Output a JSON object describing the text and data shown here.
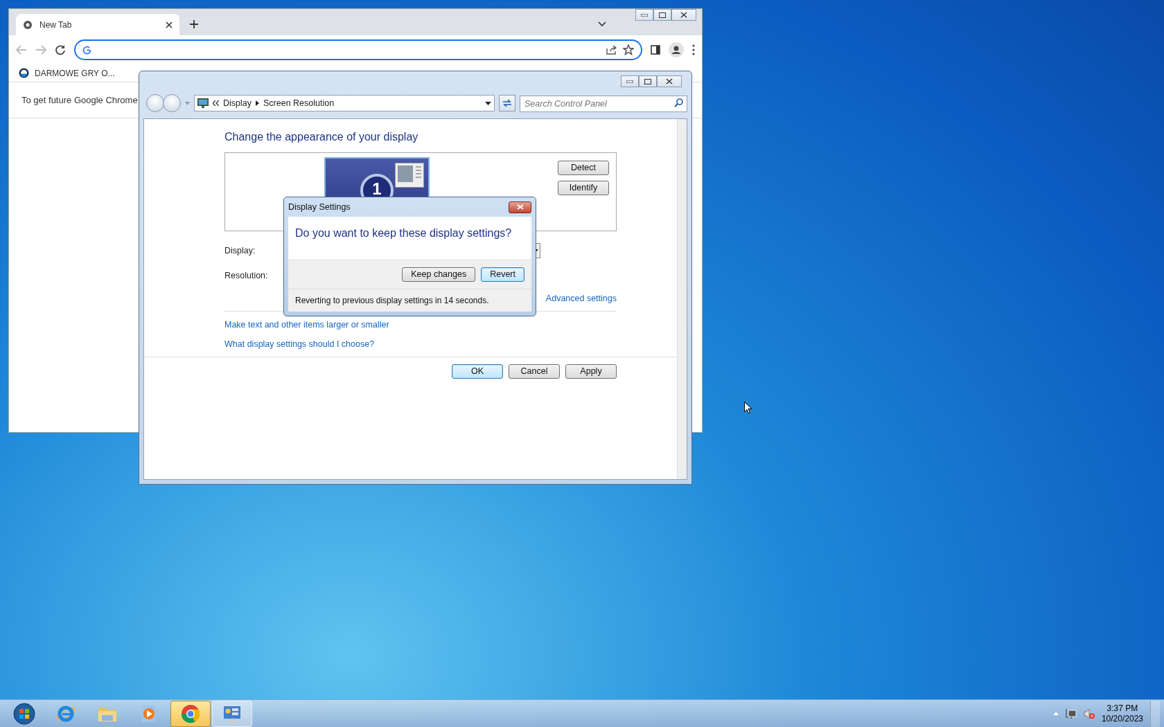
{
  "browser": {
    "tabs": [
      {
        "title": "New Tab",
        "selected": true
      }
    ],
    "bookmarks": [
      {
        "label": "DARMOWE GRY O..."
      }
    ],
    "infobar": "To get future Google Chrome"
  },
  "control_panel": {
    "breadcrumb": [
      "Display",
      "Screen Resolution"
    ],
    "search": {
      "placeholder": "Search Control Panel"
    },
    "heading": "Change the appearance of your display",
    "monitor_label": "1",
    "side_buttons": [
      "Detect",
      "Identify"
    ],
    "field_labels": [
      "Display:",
      "Resolution:"
    ],
    "advanced_link": "Advanced settings",
    "links": [
      "Make text and other items larger or smaller",
      "What display settings should I choose?"
    ],
    "buttons": [
      {
        "label": "OK",
        "default": true
      },
      {
        "label": "Cancel",
        "default": false
      },
      {
        "label": "Apply",
        "default": false
      }
    ]
  },
  "dialog": {
    "title": "Display Settings",
    "question": "Do you want to keep these display settings?",
    "buttons": [
      {
        "label": "Keep changes",
        "default": false
      },
      {
        "label": "Revert",
        "default": true
      }
    ],
    "status": "Reverting to previous display settings in 14 seconds."
  },
  "taskbar": {
    "apps": [
      {
        "kind": "ie",
        "active": false,
        "running": false
      },
      {
        "kind": "folder",
        "active": false,
        "running": false
      },
      {
        "kind": "media",
        "active": false,
        "running": false
      },
      {
        "kind": "chrome",
        "active": true,
        "running": true
      },
      {
        "kind": "control",
        "active": false,
        "running": true
      }
    ],
    "clock": {
      "time": "3:37 PM",
      "date": "10/20/2023"
    }
  }
}
